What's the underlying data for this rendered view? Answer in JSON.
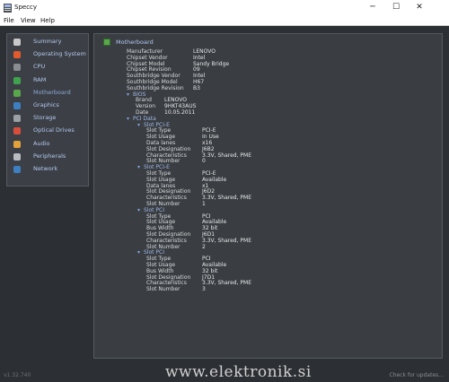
{
  "window": {
    "title": "Speccy",
    "minimize": "─",
    "maximize": "☐",
    "close": "✕"
  },
  "menu": [
    "File",
    "View",
    "Help"
  ],
  "sidebar": {
    "items": [
      {
        "label": "Summary",
        "icon": "summary-icon",
        "color": "#c9c9c9"
      },
      {
        "label": "Operating System",
        "icon": "windows-icon",
        "color": "#e45a2c"
      },
      {
        "label": "CPU",
        "icon": "cpu-icon",
        "color": "#8a8d91"
      },
      {
        "label": "RAM",
        "icon": "ram-icon",
        "color": "#3fa34d"
      },
      {
        "label": "Motherboard",
        "icon": "motherboard-icon",
        "color": "#5aa64b"
      },
      {
        "label": "Graphics",
        "icon": "graphics-icon",
        "color": "#3d7fc1"
      },
      {
        "label": "Storage",
        "icon": "storage-icon",
        "color": "#9aa0a6"
      },
      {
        "label": "Optical Drives",
        "icon": "optical-drive-icon",
        "color": "#d94e3a"
      },
      {
        "label": "Audio",
        "icon": "audio-icon",
        "color": "#e1a23a"
      },
      {
        "label": "Peripherals",
        "icon": "peripherals-icon",
        "color": "#b9bcc0"
      },
      {
        "label": "Network",
        "icon": "network-icon",
        "color": "#3d7fc1"
      }
    ],
    "selected_index": 4
  },
  "main": {
    "section_title": "Motherboard",
    "props": [
      {
        "k": "Manufacturer",
        "v": "LENOVO"
      },
      {
        "k": "Chipset Vendor",
        "v": "Intel"
      },
      {
        "k": "Chipset Model",
        "v": "Sandy Bridge"
      },
      {
        "k": "Chipset Revision",
        "v": "09"
      },
      {
        "k": "Southbridge Vendor",
        "v": "Intel"
      },
      {
        "k": "Southbridge Model",
        "v": "H67"
      },
      {
        "k": "Southbridge Revision",
        "v": "B3"
      }
    ],
    "bios": {
      "label": "BIOS",
      "rows": [
        {
          "k": "Brand",
          "v": "LENOVO"
        },
        {
          "k": "Version",
          "v": "9HKT43AUS"
        },
        {
          "k": "Date",
          "v": "10.05.2011"
        }
      ]
    },
    "pci": {
      "label": "PCI Data",
      "slots": [
        {
          "label": "Slot PCI-E",
          "rows": [
            {
              "k": "Slot Type",
              "v": "PCI-E"
            },
            {
              "k": "Slot Usage",
              "v": "In Use"
            },
            {
              "k": "Data lanes",
              "v": "x16"
            },
            {
              "k": "Slot Designation",
              "v": "J6B2"
            },
            {
              "k": "Characteristics",
              "v": "3.3V, Shared, PME"
            },
            {
              "k": "Slot Number",
              "v": "0"
            }
          ]
        },
        {
          "label": "Slot PCI-E",
          "rows": [
            {
              "k": "Slot Type",
              "v": "PCI-E"
            },
            {
              "k": "Slot Usage",
              "v": "Available"
            },
            {
              "k": "Data lanes",
              "v": "x1"
            },
            {
              "k": "Slot Designation",
              "v": "J6D2"
            },
            {
              "k": "Characteristics",
              "v": "3.3V, Shared, PME"
            },
            {
              "k": "Slot Number",
              "v": "1"
            }
          ]
        },
        {
          "label": "Slot PCI",
          "rows": [
            {
              "k": "Slot Type",
              "v": "PCI"
            },
            {
              "k": "Slot Usage",
              "v": "Available"
            },
            {
              "k": "Bus Width",
              "v": "32 bit"
            },
            {
              "k": "Slot Designation",
              "v": "J6D1"
            },
            {
              "k": "Characteristics",
              "v": "3.3V, Shared, PME"
            },
            {
              "k": "Slot Number",
              "v": "2"
            }
          ]
        },
        {
          "label": "Slot PCI",
          "rows": [
            {
              "k": "Slot Type",
              "v": "PCI"
            },
            {
              "k": "Slot Usage",
              "v": "Available"
            },
            {
              "k": "Bus Width",
              "v": "32 bit"
            },
            {
              "k": "Slot Designation",
              "v": "J7D1"
            },
            {
              "k": "Characteristics",
              "v": "3.3V, Shared, PME"
            },
            {
              "k": "Slot Number",
              "v": "3"
            }
          ]
        }
      ]
    }
  },
  "status": {
    "version": "v1.32.740",
    "right": "Check for updates...",
    "watermark": "www.elektronik.si"
  }
}
